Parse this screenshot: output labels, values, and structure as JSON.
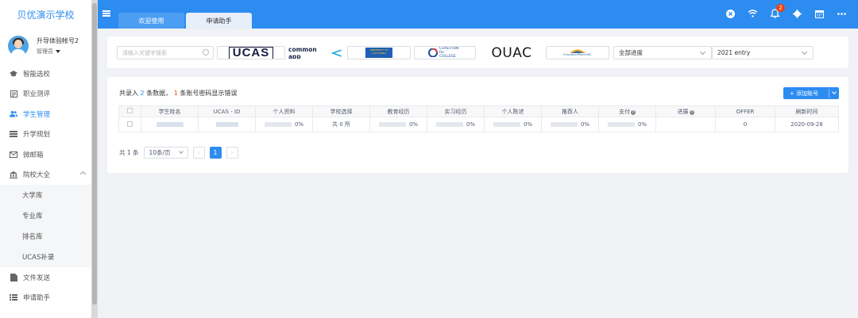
{
  "app": {
    "school_name": "贝优演示学校",
    "user_name": "升导体验帐号2",
    "user_role": "管理员"
  },
  "sidebar": {
    "items": [
      {
        "label": "智能选校",
        "icon": "graduation-cap-icon"
      },
      {
        "label": "职业测评",
        "icon": "assessment-icon"
      },
      {
        "label": "学生管理",
        "icon": "users-icon",
        "active": true
      },
      {
        "label": "升学规划",
        "icon": "plan-icon"
      },
      {
        "label": "微邮箱",
        "icon": "mail-icon"
      },
      {
        "label": "院校大全",
        "icon": "institution-icon",
        "expanded": true
      }
    ],
    "sub_items": [
      "大学库",
      "专业库",
      "排名库",
      "UCAS补录"
    ],
    "bottom_items": [
      {
        "label": "文件发送",
        "icon": "file-send-icon"
      },
      {
        "label": "申请助手",
        "icon": "list-icon"
      }
    ]
  },
  "topbar": {
    "tabs": [
      "欢迎使用",
      "申请助手"
    ],
    "notification_count": "2",
    "icons": [
      "close-circle-icon",
      "wifi-icon",
      "bell-icon",
      "gear-icon",
      "calendar-icon",
      "more-icon"
    ]
  },
  "filters": {
    "search_placeholder": "请输入关键字搜索",
    "platforms": [
      "UCAS",
      "common app",
      "UNIVERSITY OF CALIFORNIA",
      "COALITION for COLLEGE",
      "OUAC",
      "EducationPlannerBC"
    ],
    "progress_select": "全部进度",
    "entry_select": "2021 entry"
  },
  "summary": {
    "prefix": "共录入",
    "count": "2",
    "mid": "条数据，",
    "error_count": "1",
    "suffix": "条账号密码显示错误"
  },
  "add_button": "+ 添加账号",
  "table": {
    "headers": [
      "学生姓名",
      "UCAS - ID",
      "个人资料",
      "学校选择",
      "教育经历",
      "实习经历",
      "个人陈述",
      "推荐人",
      "支付",
      "进展",
      "OFFER",
      "刷新时间"
    ],
    "rows": [
      {
        "profile": "0%",
        "school_choice": "共 0 所",
        "education": "0%",
        "internship": "0%",
        "statement": "0%",
        "referee": "0%",
        "payment": "0%",
        "progress": "",
        "offer": "0",
        "refresh_time": "2020-09-28"
      }
    ]
  },
  "pagination": {
    "total": "共 1 条",
    "page_size": "10条/页",
    "current_page": "1"
  },
  "colors": {
    "primary": "#2d8cf0",
    "danger": "#ed4014"
  }
}
